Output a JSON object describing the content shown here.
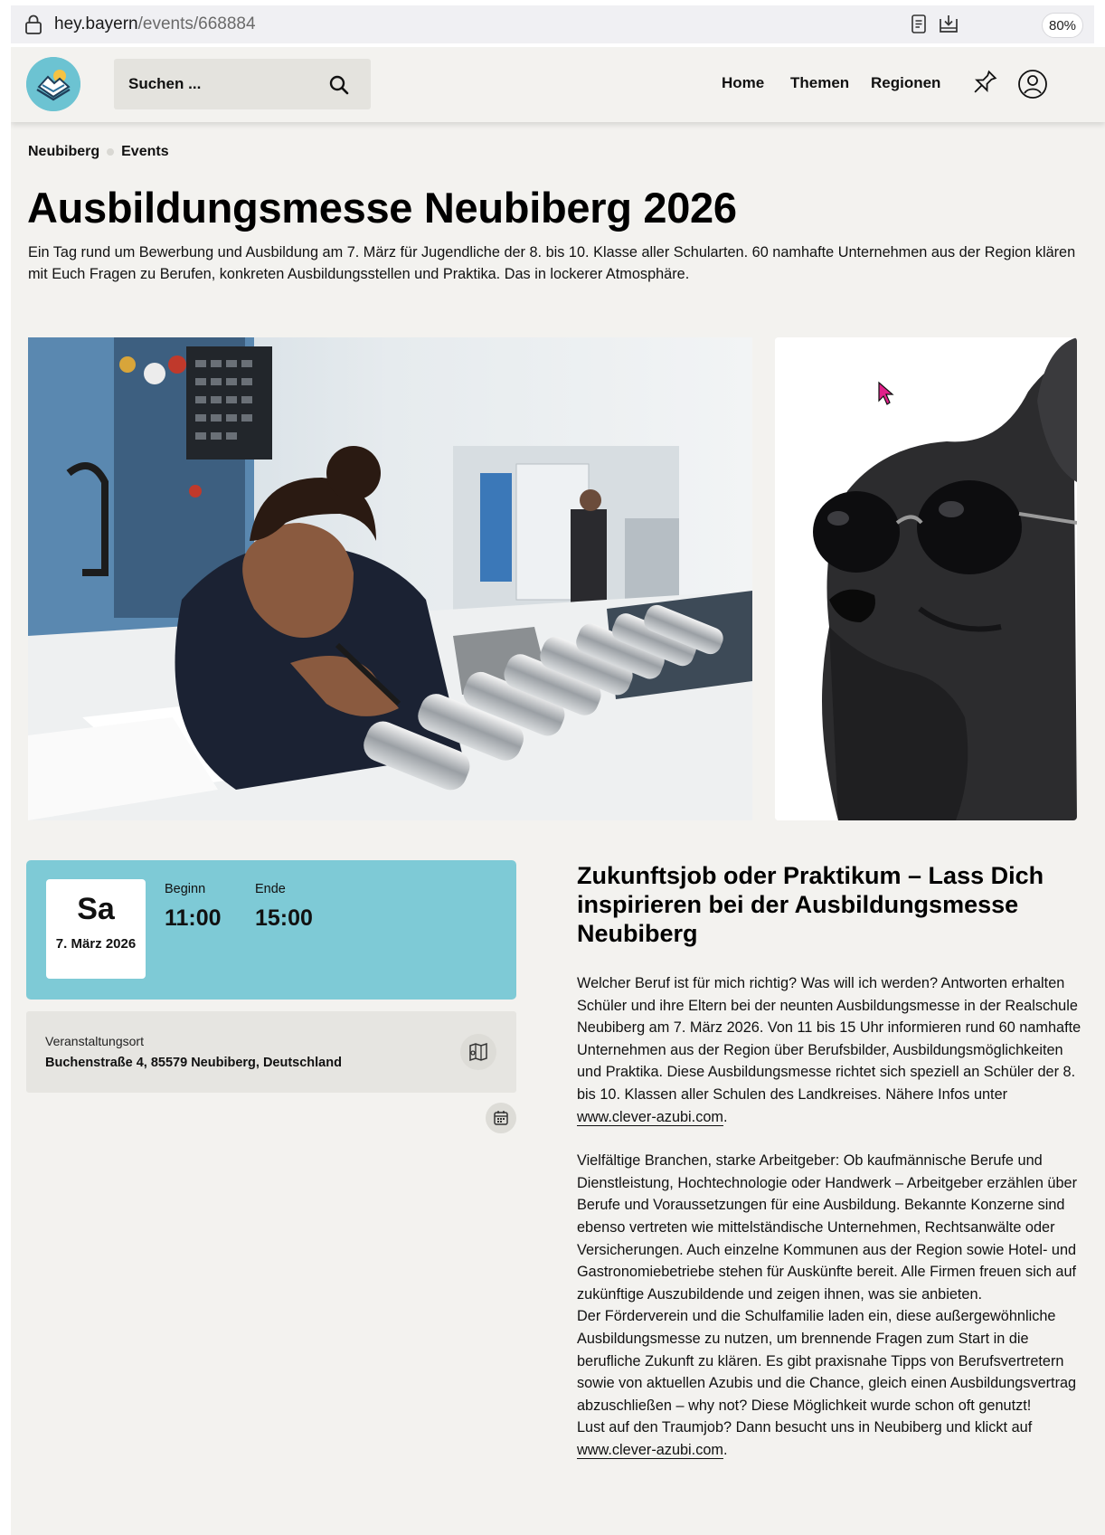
{
  "browser": {
    "url_host": "hey.bayern",
    "url_path": "/events/668884",
    "zoom": "80%"
  },
  "header": {
    "search_placeholder": "Suchen ...",
    "nav": [
      "Home",
      "Themen",
      "Regionen"
    ]
  },
  "breadcrumb": [
    "Neubiberg",
    "Events"
  ],
  "event": {
    "title": "Ausbildungsmesse Neubiberg 2026",
    "lead": "Ein Tag rund um Bewerbung und Ausbildung am 7. März für Jugendliche der 8. bis 10. Klasse aller Schularten. 60 namhafte Unternehmen aus der Region klären mit Euch Fragen zu Berufen, konkreten Ausbildungsstellen und Praktika. Das in lockerer Atmosphäre.",
    "date": {
      "weekday": "Sa",
      "date": "7. März 2026",
      "begin_label": "Beginn",
      "begin": "11:00",
      "end_label": "Ende",
      "end": "15:00"
    },
    "venue": {
      "label": "Veranstaltungsort",
      "address": "Buchenstraße 4, 85579 Neubiberg, Deutschland"
    },
    "subtitle": "Zukunftsjob oder Praktikum – Lass Dich inspirieren bei der Ausbildungsmesse Neubiberg",
    "paragraph1": "Welcher Beruf ist für mich richtig? Was will ich werden? Antworten erhalten Schüler und ihre Eltern bei der neunten Ausbildungsmesse in der Realschule Neubiberg am 7. März 2026. Von 11 bis 15 Uhr informieren rund 60 namhafte Unternehmen aus der Region über Berufsbilder, Ausbildungsmöglichkeiten und Praktika. Diese Ausbildungsmesse richtet sich speziell an Schüler der 8. bis 10. Klassen aller Schulen des Landkreises. Nähere Infos unter",
    "link": "www.clever-azubi.com",
    "paragraph2a": "Vielfältige Branchen, starke Arbeitgeber: Ob kaufmännische Berufe und Dienstleistung, Hochtechnologie oder Handwerk – Arbeitgeber erzählen über Berufe und Voraussetzungen für eine Ausbildung. Bekannte Konzerne sind ebenso vertreten wie mittelständische Unternehmen, Rechtsanwälte oder Versicherungen. Auch einzelne Kommunen aus der Region sowie Hotel- und Gastronomiebetriebe stehen für Auskünfte bereit. Alle Firmen freuen sich auf zukünftige Auszubildende und zeigen ihnen, was sie anbieten.",
    "paragraph2b": "Der Förderverein und die Schulfamilie laden ein, diese außergewöhnliche Ausbildungsmesse zu nutzen, um brennende Fragen zum Start in die berufliche Zukunft zu klären. Es gibt praxisnahe Tipps von Berufsvertretern sowie von aktuellen Azubis und die Chance, gleich einen Ausbildungsvertrag abzuschließen – why not? Diese Möglichkeit wurde schon oft genutzt!",
    "paragraph2c": "Lust auf den Traumjob? Dann besucht uns in Neubiberg und klickt auf"
  },
  "colors": {
    "page_bg": "#f3f2ef",
    "accent_teal": "#7ecad6",
    "card_grey": "#e6e5e1"
  },
  "icons": [
    "lock-icon",
    "reader-icon",
    "download-icon",
    "logo-icon",
    "search-icon",
    "pin-icon",
    "user-icon",
    "map-icon",
    "calendar-icon"
  ]
}
